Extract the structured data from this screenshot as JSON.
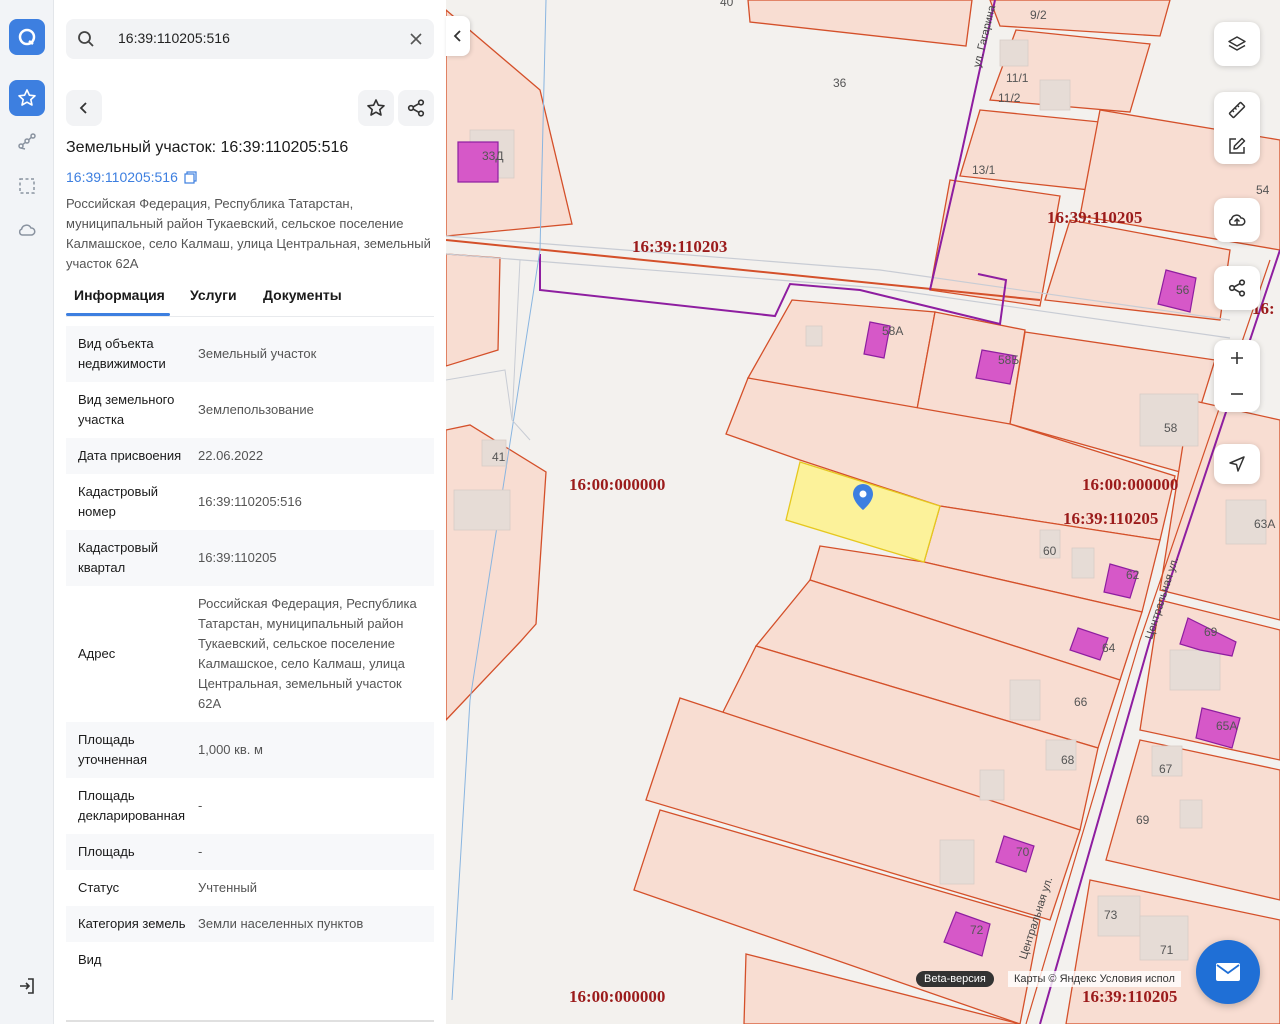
{
  "colors": {
    "accent": "#3d7fe0",
    "parcel_fill": "#f8ddd2",
    "parcel_stroke": "#d4502a",
    "building": "#d658c8",
    "selected": "#fcf29a",
    "cad_label": "#9b1b1b"
  },
  "rail": {
    "icons": [
      "logo-icon",
      "star-icon",
      "route-icon",
      "selection-icon",
      "cloud-icon",
      "logout-icon"
    ]
  },
  "search": {
    "value": "16:39:110205:516"
  },
  "object": {
    "title": "Земельный участок: 16:39:110205:516",
    "cadastral_link": "16:39:110205:516",
    "address": "Российская Федерация, Республика Татарстан, муниципальный район Тукаевский, сельское поселение Калмашское, село Калмаш, улица Центральная, земельный участок 62А"
  },
  "tabs": [
    {
      "label": "Информация"
    },
    {
      "label": "Услуги"
    },
    {
      "label": "Документы"
    }
  ],
  "rows": [
    {
      "key": "Вид объекта недвижимости",
      "value": "Земельный участок"
    },
    {
      "key": "Вид земельного участка",
      "value": "Землепользование"
    },
    {
      "key": "Дата присвоения",
      "value": "22.06.2022"
    },
    {
      "key": "Кадастровый номер",
      "value": "16:39:110205:516"
    },
    {
      "key": "Кадастровый квартал",
      "value": "16:39:110205"
    },
    {
      "key": "Адрес",
      "value": "Российская Федерация, Республика Татарстан, муниципальный район Тукаевский, сельское поселение Калмашское, село Калмаш, улица Центральная, земельный участок 62А"
    },
    {
      "key": "Площадь уточненная",
      "value": "1,000 кв. м"
    },
    {
      "key": "Площадь декларированная",
      "value": "-"
    },
    {
      "key": "Площадь",
      "value": "-"
    },
    {
      "key": "Статус",
      "value": "Учтенный"
    },
    {
      "key": "Категория земель",
      "value": "Земли населенных пунктов"
    },
    {
      "key": "Вид",
      "value": ""
    }
  ],
  "map": {
    "cad_labels": [
      {
        "text": "16:39:110203"
      },
      {
        "text": "16:39:110205"
      },
      {
        "text": "16:00:000000"
      },
      {
        "text": "16:00:000000"
      },
      {
        "text": "16:39:110205"
      },
      {
        "text": "16:00:000000"
      },
      {
        "text": "16:39:110205"
      },
      {
        "text": "16:"
      }
    ],
    "house_numbers": [
      "40",
      "36",
      "9/2",
      "11/1",
      "11/2",
      "13/1",
      "33Д",
      "54",
      "56",
      "58А",
      "58Б",
      "58",
      "41",
      "60",
      "62",
      "63А",
      "64",
      "69",
      "66",
      "65А",
      "68",
      "67",
      "69",
      "70",
      "72",
      "73",
      "71"
    ],
    "streets": [
      "ул. Гагарина",
      "Центральная ул.",
      "Центральная ул."
    ],
    "beta": "Beta-версия",
    "attribution": "Карты © Яндекс   Условия испол"
  }
}
